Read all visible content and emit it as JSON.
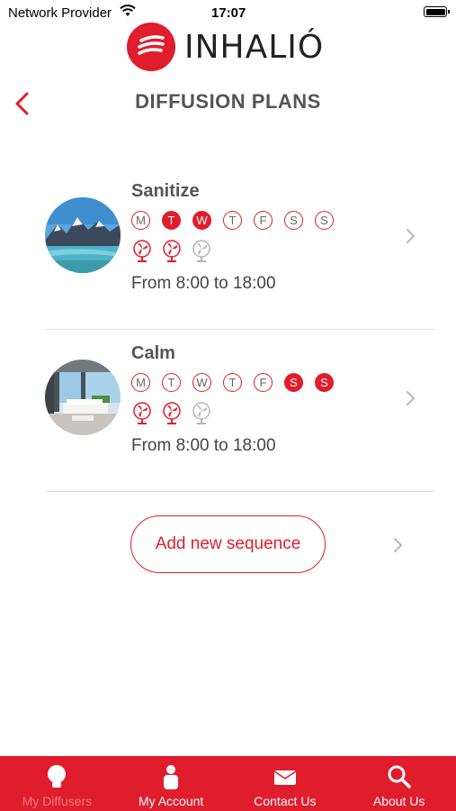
{
  "status_bar": {
    "carrier": "Network Provider",
    "time": "17:07"
  },
  "brand": {
    "name": "INHALIÓ",
    "accent": "#e01d2c"
  },
  "header": {
    "title": "DIFFUSION PLANS",
    "back_icon": "chevron-left-icon"
  },
  "plans": [
    {
      "name": "Sanitize",
      "days": [
        {
          "label": "M",
          "active": false
        },
        {
          "label": "T",
          "active": true
        },
        {
          "label": "W",
          "active": true
        },
        {
          "label": "T",
          "active": false
        },
        {
          "label": "F",
          "active": false
        },
        {
          "label": "S",
          "active": false
        },
        {
          "label": "S",
          "active": false
        }
      ],
      "fans": [
        {
          "active": true
        },
        {
          "active": true
        },
        {
          "active": false
        }
      ],
      "time_range": "From 8:00 to 18:00"
    },
    {
      "name": "Calm",
      "days": [
        {
          "label": "M",
          "active": false
        },
        {
          "label": "T",
          "active": false
        },
        {
          "label": "W",
          "active": false
        },
        {
          "label": "T",
          "active": false
        },
        {
          "label": "F",
          "active": false
        },
        {
          "label": "S",
          "active": true
        },
        {
          "label": "S",
          "active": true
        }
      ],
      "fans": [
        {
          "active": true
        },
        {
          "active": true
        },
        {
          "active": false
        }
      ],
      "time_range": "From 8:00 to 18:00"
    }
  ],
  "add_button": {
    "label": "Add new sequence"
  },
  "tabbar": {
    "items": [
      {
        "label": "My Diffusers",
        "icon": "diffuser-icon",
        "selected": true
      },
      {
        "label": "My Account",
        "icon": "person-icon",
        "selected": false
      },
      {
        "label": "Contact Us",
        "icon": "envelope-icon",
        "selected": false
      },
      {
        "label": "About Us",
        "icon": "search-icon",
        "selected": false
      }
    ]
  }
}
